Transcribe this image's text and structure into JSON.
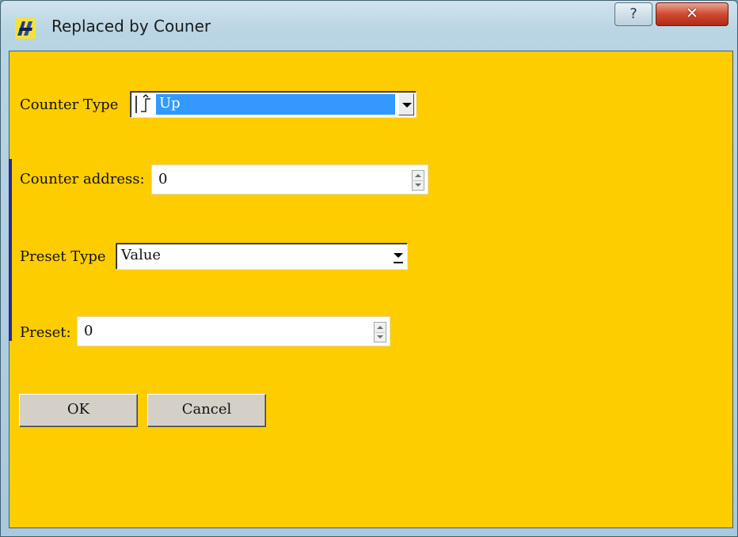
{
  "window": {
    "title": "Replaced by Couner",
    "help_label": "?",
    "close_label": "✕"
  },
  "form": {
    "counter_type": {
      "label": "Counter Type",
      "value": "Up",
      "icon": "up-counter-icon"
    },
    "counter_address": {
      "label": "Counter address:",
      "value": "0"
    },
    "preset_type": {
      "label": "Preset Type",
      "value": "Value"
    },
    "preset": {
      "label": "Preset:",
      "value": "0"
    }
  },
  "buttons": {
    "ok": "OK",
    "cancel": "Cancel"
  },
  "colors": {
    "client_background": "#fecd00",
    "selection": "#3399ff",
    "close_button": "#c8412a"
  }
}
